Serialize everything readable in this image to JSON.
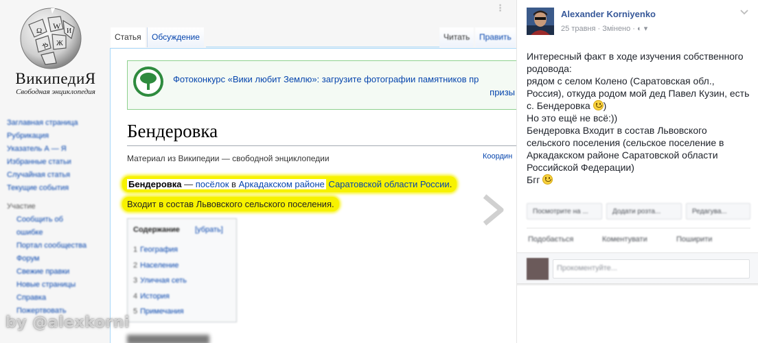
{
  "wiki": {
    "wordmark": "ВикипедиЯ",
    "tagline": "Свободная энциклопедия",
    "nav_main": [
      "Заглавная страница",
      "Рубрикация",
      "Указатель А — Я",
      "Избранные статьи",
      "Случайная статья",
      "Текущие события"
    ],
    "nav_participation_head": "Участие",
    "nav_participation": [
      "Сообщить об",
      "ошибке",
      "Портал сообщества",
      "Форум",
      "Свежие правки",
      "Новые страницы",
      "Справка",
      "Пожертвовать"
    ],
    "tabs": {
      "article": "Статья",
      "discussion": "Обсуждение",
      "read": "Читать",
      "edit": "Править"
    },
    "banner": {
      "line1": "Фотоконкурс «Вики любит Землю»: загрузите фотографии памятников пр",
      "line2": "призы"
    },
    "title": "Бендеровка",
    "subtitle": "Материал из Википедии — свободной энциклопедии",
    "coords": "Координ",
    "para1": {
      "bold": "Бендеровка",
      "dash": " — ",
      "link1": "посёлок",
      "in": " в ",
      "link2": "Аркадакском районе",
      "link3": "Саратовской области",
      "link4": "России",
      "end": "."
    },
    "para2": "Входит в состав Львовского сельского поселения.",
    "toc": {
      "title": "Содержание",
      "hide": "[убрать]",
      "items": [
        {
          "num": "1",
          "label": "География"
        },
        {
          "num": "2",
          "label": "Население"
        },
        {
          "num": "3",
          "label": "Уличная сеть"
        },
        {
          "num": "4",
          "label": "История"
        },
        {
          "num": "5",
          "label": "Примечания"
        }
      ]
    }
  },
  "watermark": "by @alexkorni",
  "fb": {
    "author": "Alexander Korniyenko",
    "meta": "25 травня · Змінено · ",
    "lines": [
      "Интересный факт в ходе изучения собственного родовода:",
      "рядом с селом Колено (Саратовская обл., Россия), откуда родом мой дед Павел Кузин, есть с. Бендеровка",
      "Но это ещё не всё:))",
      "Бендеровка Входит в состав Львовского сельского поселения (сельское поселение в Аркадакском районе Саратовской области Российской Федерации)",
      "Бгг"
    ],
    "line2_suffix": ")",
    "pills": [
      "Посмотрите на ...",
      "Додати розта...",
      "Редагува..."
    ],
    "reactions": {
      "share": "Подобається",
      "comment": "Коментувати",
      "follow": "Поширити"
    },
    "comment_placeholder": "Прокоментуйте..."
  },
  "colors": {
    "highlight": "#f7f200",
    "wiki_link": "#0645ad",
    "fb_name": "#365899"
  }
}
